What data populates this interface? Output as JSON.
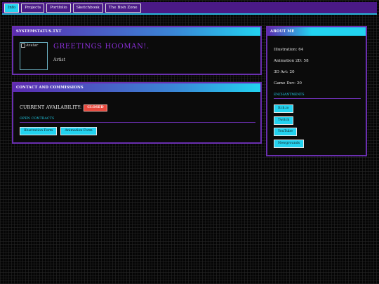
{
  "nav": {
    "tabs": [
      {
        "label": "Info",
        "active": true
      },
      {
        "label": "Projects",
        "active": false
      },
      {
        "label": "Portfolio",
        "active": false
      },
      {
        "label": "Sketchbook",
        "active": false
      },
      {
        "label": "The Bish Zone",
        "active": false
      }
    ]
  },
  "status": {
    "title": "SYSTEMSTATUS.TXT",
    "avatar_alt": "Avatar",
    "greeting": "GREETINGS HOOMAN!.",
    "role": "Artist"
  },
  "contact": {
    "title": "CONTACT AND COMMISSIONS",
    "availability_label": "CURRENT AVAILABILITY:",
    "availability_value": "CLOSED",
    "open_contracts_label": "OPEN CONTRACTS",
    "buttons": [
      "Illustration Form",
      "Animation Form"
    ]
  },
  "about": {
    "title": "ABOUT ME",
    "stats": [
      {
        "label": "Illustration",
        "value": "64"
      },
      {
        "label": "Animation 2D",
        "value": "58"
      },
      {
        "label": "3D Art",
        "value": "20"
      },
      {
        "label": "Game Dev",
        "value": "20"
      }
    ],
    "stat_lines": [
      "Illustration: 64",
      "Animation 2D: 58",
      "3D Art: 20",
      "Game Dev: 20"
    ],
    "entertainment_label": "ENCHANTMENTS",
    "links": [
      "Itch.io",
      "Twitch",
      "YouTube",
      "Newgrounds"
    ]
  },
  "colors": {
    "accent_cyan": "#22d3f0",
    "nav_purple": "#4a1a86",
    "panel_border": "#6a2fb0",
    "greeting_purple": "#8a2fd8",
    "closed_red": "#e8493e"
  }
}
